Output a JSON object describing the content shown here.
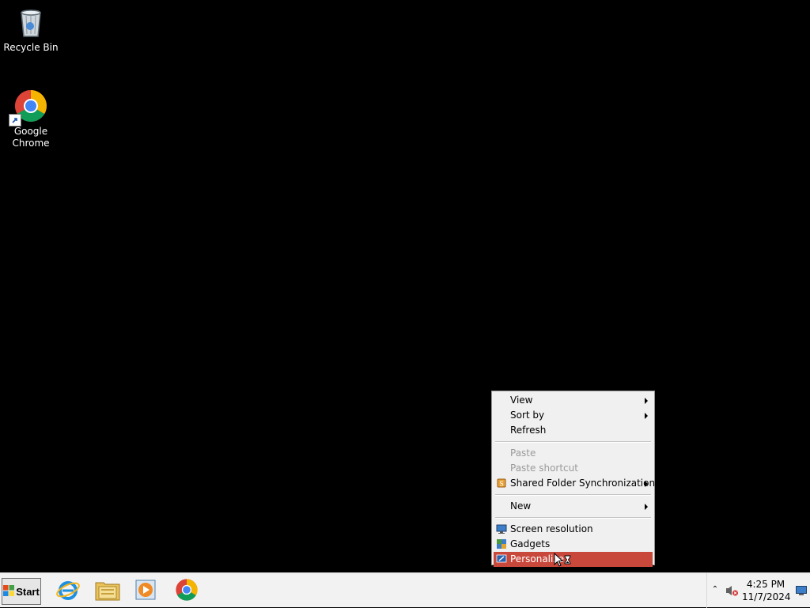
{
  "desktop": {
    "icons": [
      {
        "label": "Recycle Bin",
        "icon": "recycle-bin-icon"
      },
      {
        "label": "Google\nChrome",
        "icon": "chrome-icon"
      }
    ]
  },
  "context_menu": {
    "items": [
      {
        "label": "View",
        "submenu": true
      },
      {
        "label": "Sort by",
        "submenu": true
      },
      {
        "label": "Refresh"
      },
      {
        "label": "Paste",
        "disabled": true
      },
      {
        "label": "Paste shortcut",
        "disabled": true
      },
      {
        "label": "Shared Folder Synchronization",
        "submenu": true,
        "icon": "sync-icon"
      },
      {
        "label": "New",
        "submenu": true
      },
      {
        "label": "Screen resolution",
        "icon": "screen-resolution-icon"
      },
      {
        "label": "Gadgets",
        "icon": "gadgets-icon"
      },
      {
        "label": "Personalize",
        "icon": "personalize-icon",
        "highlighted": true
      }
    ]
  },
  "taskbar": {
    "start_label": "Start",
    "pinned": [
      {
        "name": "Internet Explorer",
        "icon": "internet-explorer-icon"
      },
      {
        "name": "Windows Explorer",
        "icon": "folder-icon"
      },
      {
        "name": "Windows Media Player",
        "icon": "media-player-icon"
      },
      {
        "name": "Google Chrome",
        "icon": "chrome-icon"
      }
    ],
    "tray": {
      "expand_glyph": "⌃",
      "time": "4:25 PM",
      "date": "11/7/2024"
    }
  },
  "colors": {
    "highlight": "#c9483c",
    "desktop_bg": "#000000",
    "taskbar_bg": "#f2f2f2"
  }
}
